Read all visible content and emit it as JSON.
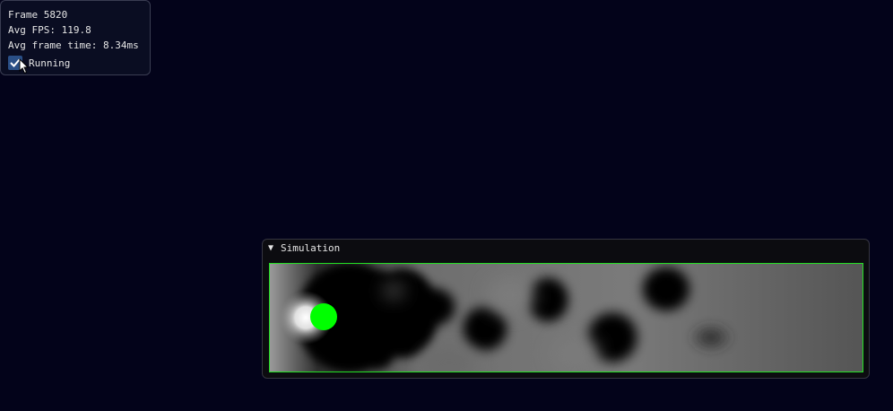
{
  "stats": {
    "frame": "Frame 5820",
    "fps": "Avg FPS: 119.8",
    "frame_time": "Avg frame time: 8.34ms",
    "running_label": "Running",
    "running_checked": true
  },
  "simulation": {
    "title": "Simulation",
    "collapse_arrow": "▼",
    "obstacle_color": "#00ff00",
    "border_color": "#22e022"
  },
  "icons": {
    "checkbox": "checkmark-icon",
    "cursor": "mouse-cursor-icon",
    "collapse": "collapse-arrow-icon"
  }
}
